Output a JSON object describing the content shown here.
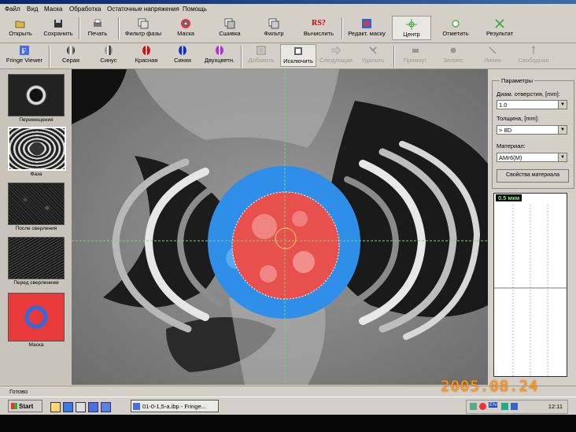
{
  "menu": [
    "Файл",
    "Вид",
    "Маска",
    "Обработка",
    "Остаточные напряжения",
    "Помощь"
  ],
  "toolbar1": [
    {
      "label": "Открыть",
      "icon": "folder-open-icon"
    },
    {
      "label": "Сохранить",
      "icon": "floppy-disk-icon"
    },
    {
      "label": "Печать",
      "icon": "printer-icon"
    },
    {
      "label": "Фильтр фазы",
      "icon": "phase-filter-icon"
    },
    {
      "label": "Маска",
      "icon": "mask-icon"
    },
    {
      "label": "Сшивка",
      "icon": "stitch-icon"
    },
    {
      "label": "Фильтр",
      "icon": "filter-icon"
    },
    {
      "label": "Вычислить",
      "icon": "rs-compute-icon",
      "glyph": "RS?"
    },
    {
      "label": "Редакт. маску",
      "icon": "edit-mask-icon"
    },
    {
      "label": "Центр",
      "icon": "center-crosshair-icon"
    },
    {
      "label": "Отметить",
      "icon": "mark-point-icon"
    },
    {
      "label": "Результат",
      "icon": "result-icon"
    }
  ],
  "toolbar2": [
    {
      "label": "Fringe Viewer",
      "icon": "fringe-viewer-icon"
    },
    {
      "label": "Серая",
      "icon": "gray-palette-icon"
    },
    {
      "label": "Синус",
      "icon": "sine-palette-icon"
    },
    {
      "label": "Красная",
      "icon": "red-palette-icon"
    },
    {
      "label": "Синяя",
      "icon": "blue-palette-icon"
    },
    {
      "label": "Двухцветн.",
      "icon": "two-color-palette-icon"
    },
    {
      "label": "Добавить",
      "icon": "add-icon"
    },
    {
      "label": "Исключить",
      "icon": "exclude-icon"
    },
    {
      "label": "Следующая",
      "icon": "next-arrow-icon"
    },
    {
      "label": "Удалить",
      "icon": "delete-icon"
    },
    {
      "label": "Прямоуг.",
      "icon": "rectangle-icon"
    },
    {
      "label": "Эллипс",
      "icon": "ellipse-icon"
    },
    {
      "label": "Линия",
      "icon": "line-icon"
    },
    {
      "label": "Свободная",
      "icon": "freehand-icon"
    }
  ],
  "thumbnails": [
    "Перемещения",
    "Фаза",
    "После сверления",
    "Перед сверлением",
    "Маска"
  ],
  "params": {
    "title": "Параметры",
    "hole_label": "Диам. отверстия, [mm]:",
    "hole_value": "1.0",
    "thickness_label": "Толщина, [mm]:",
    "thickness_value": "> 8D",
    "material_label": "Материал:",
    "material_value": "АМг6(М)",
    "material_button": "Свойства материала"
  },
  "graph": {
    "scale_label": "0.5 мкм"
  },
  "status": "Готово",
  "taskbar": {
    "start": "Start",
    "item": "01-0-1,5-a.ibp - Fringe...",
    "clock": "12:11",
    "lang": "EN"
  },
  "photo_date": "2005.08.24",
  "colors": {
    "accent_red": "#e8504e",
    "accent_blue": "#2f8fe8",
    "crosshair": "#7ad17a"
  }
}
